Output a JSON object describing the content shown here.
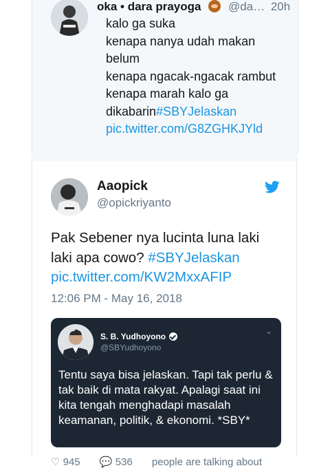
{
  "top_tweet": {
    "name": "oka • dara prayoga",
    "handle": "@da…",
    "time": "20h",
    "lines": [
      "kalo ga suka",
      "kenapa nanya udah makan",
      "belum",
      "kenapa ngacak-ngacak rambut",
      "kenapa marah kalo ga"
    ],
    "last_line_text": "dikabarin",
    "hashtag": "#SBYJelaskan",
    "link": "pic.twitter.com/G8ZGHKJYld"
  },
  "main_tweet": {
    "name": "Aaopick",
    "handle": "@opickriyanto",
    "text": "Pak Sebener nya lucinta luna laki laki apa cowo?",
    "hashtag": "#SBYJelaskan",
    "link": "pic.twitter.com/KW2MxxAFIP",
    "timestamp": "12:06 PM - May 16, 2018",
    "embedded": {
      "name": "S. B. Yudhoyono",
      "handle": "@SBYudhoyono",
      "text": "Tentu saya bisa jelaskan. Tapi tak perlu & tak baik di mata rakyat. Apalagi saat ini kita tengah menghadapi masalah keamanan, politik, & ekonomi. *SBY*"
    },
    "actions": {
      "likes": "945",
      "replies": "536",
      "extra": "people are talking about"
    }
  },
  "colors": {
    "link": "#1b95e0",
    "muted": "#657786",
    "text": "#14171a",
    "twitter_blue": "#1da1f2"
  }
}
